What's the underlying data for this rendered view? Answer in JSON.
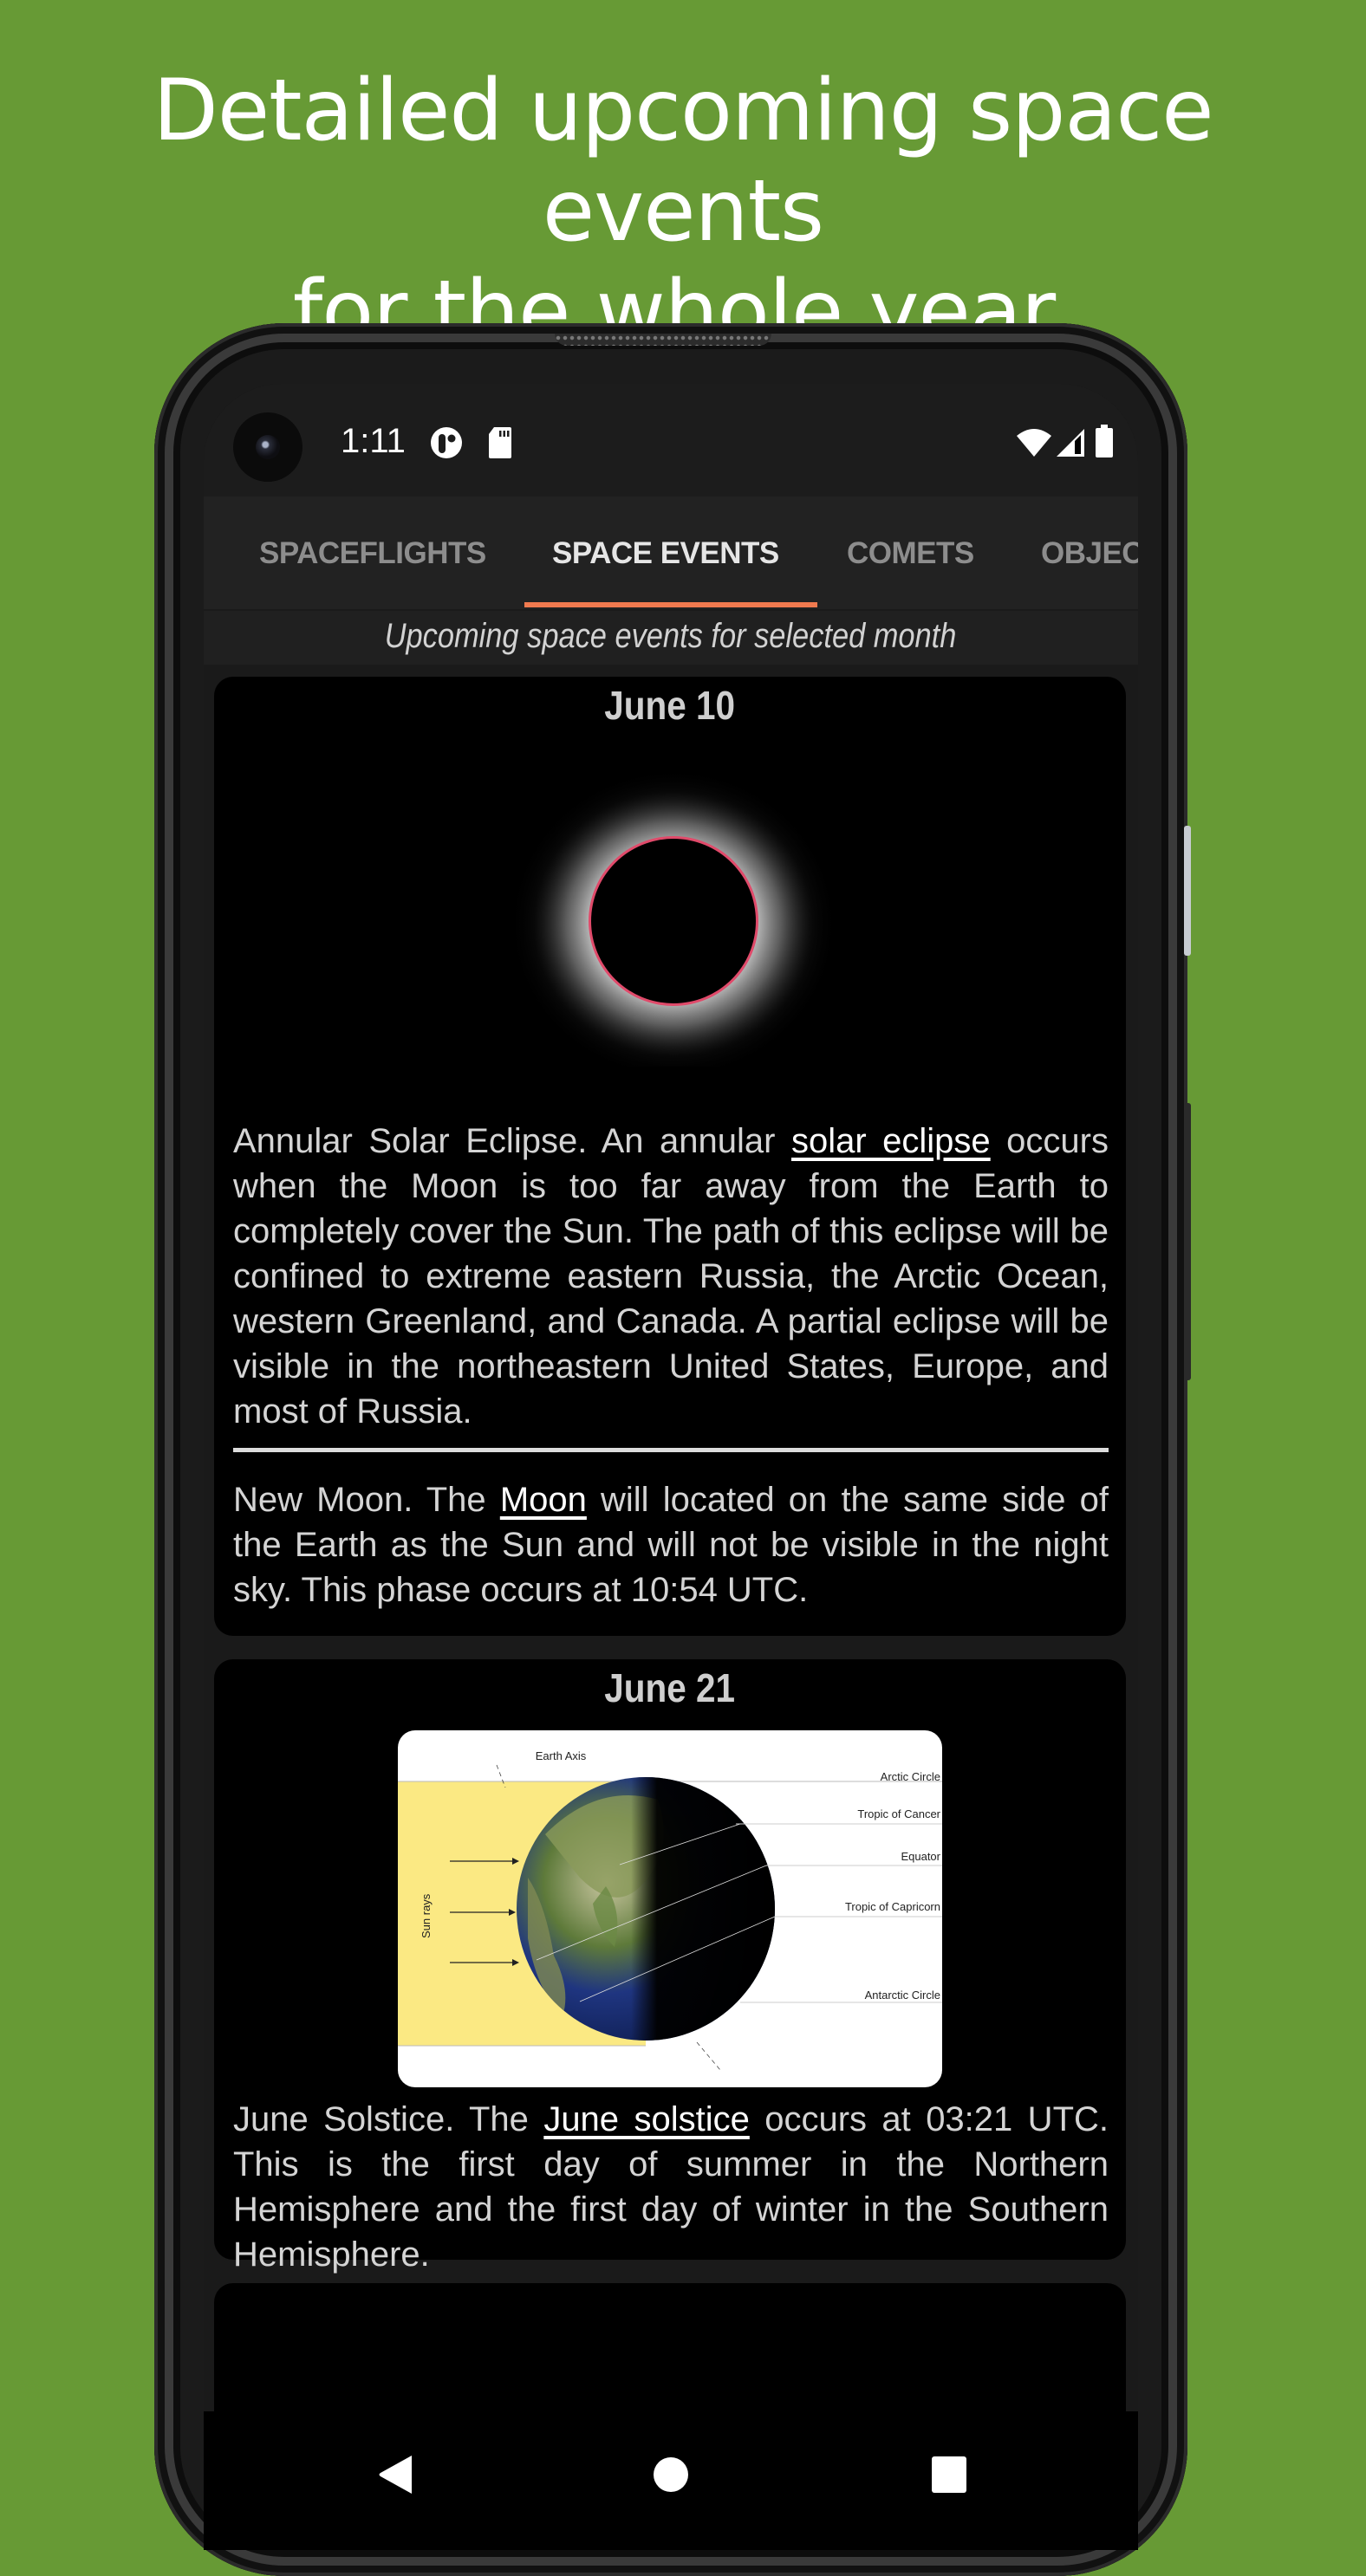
{
  "headline": {
    "line1": "Detailed upcoming space events",
    "line2": "for the whole year."
  },
  "colors": {
    "background": "#679a35",
    "tab_indicator": "#f07a4f",
    "card_bg": "#000000",
    "text": "#d4d4d4"
  },
  "status_bar": {
    "time": "1:11",
    "left_icons": [
      "app-notification-icon",
      "sd-card-icon"
    ],
    "right_icons": [
      "wifi-icon",
      "cell-signal-icon",
      "battery-icon"
    ]
  },
  "tabs": [
    {
      "label": "SPACEFLIGHTS",
      "active": false
    },
    {
      "label": "SPACE EVENTS",
      "active": true
    },
    {
      "label": "COMETS",
      "active": false
    },
    {
      "label": "OBJEC",
      "active": false
    }
  ],
  "subtitle": "Upcoming space events for selected month",
  "events": [
    {
      "date": "June 10",
      "image": "solar-eclipse-image",
      "items": [
        {
          "before": "Annular Solar Eclipse. An annular ",
          "link": "solar eclipse",
          "after": " occurs when the Moon is too far away from the Earth to completely cover the Sun. The path of this eclipse will be confined to extreme eastern Russia, the Arctic Ocean, western Greenland, and Canada. A partial eclipse will be visible in the northeastern United States, Europe, and most of Russia."
        },
        {
          "before": "New Moon. The ",
          "link": "Moon",
          "after": " will located on the same side of the Earth as the Sun and will not be visible in the night sky. This phase occurs at 10:54 UTC."
        }
      ]
    },
    {
      "date": "June 21",
      "image": "solstice-diagram-image",
      "diagram_labels": {
        "earth_axis": "Earth Axis",
        "sun_rays": "Sun rays",
        "arctic_circle": "Arctic Circle",
        "tropic_cancer": "Tropic of Cancer",
        "equator": "Equator",
        "tropic_capricorn": "Tropic of Capricorn",
        "antarctic_circle": "Antarctic Circle"
      },
      "items": [
        {
          "before": "June Solstice. The ",
          "link": "June solstice",
          "after": " occurs at 03:21 UTC. This is the first day of summer in the Northern Hemisphere and the first day of winter in the Southern Hemisphere."
        }
      ]
    }
  ],
  "nav": {
    "back": "back-icon",
    "home": "home-icon",
    "recents": "recents-icon"
  }
}
